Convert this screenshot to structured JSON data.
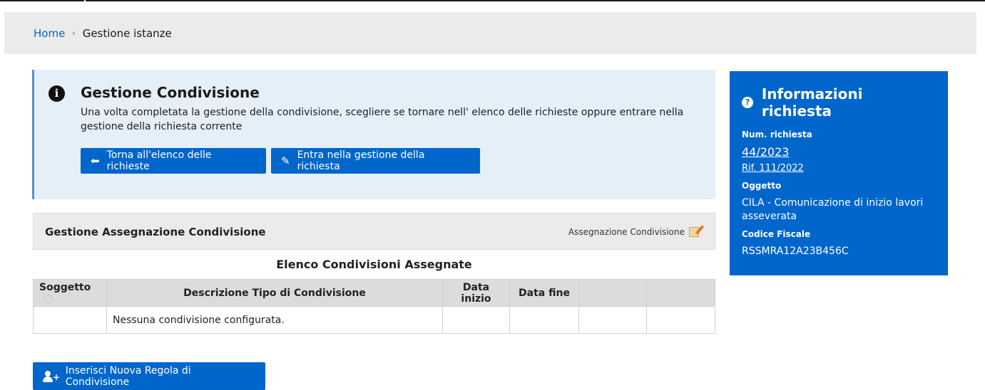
{
  "breadcrumb": {
    "home": "Home",
    "separator": "›",
    "current": "Gestione istanze"
  },
  "info": {
    "icon": "info-icon",
    "title": "Gestione Condivisione",
    "text": "Una volta completata la gestione della condivisione, scegliere se tornare nell' elenco delle richieste oppure entrare nella gestione della richiesta corrente",
    "back_button": "Torna all'elenco delle richieste",
    "back_icon": "⬅",
    "enter_button": "Entra nella gestione della richiesta",
    "enter_icon": "✎"
  },
  "assignment": {
    "title": "Gestione Assegnazione Condivisione",
    "link": "Assegnazione Condivisione",
    "table_caption": "Elenco Condivisioni Assegnate",
    "columns": [
      "Soggetto",
      "Descrizione Tipo di Condivisione",
      "Data inizio",
      "Data fine",
      "",
      ""
    ],
    "empty_row": "Nessuna condivisione configurata."
  },
  "new_rule_button": "Inserisci Nuova Regola di Condivisione",
  "sidebar": {
    "title": "Informazioni richiesta",
    "num_label": "Num. richiesta",
    "num_value": "44/2023",
    "rif": "Rif. 111/2022",
    "oggetto_label": "Oggetto",
    "oggetto_value": "CILA - Comunicazione di inizio lavori asseverata",
    "cf_label": "Codice Fiscale",
    "cf_value": "RSSMRA12A23B456C"
  },
  "colors": {
    "primary": "#0066cc",
    "info_bg": "#e5eff7",
    "bar_bg": "#ebebeb"
  }
}
